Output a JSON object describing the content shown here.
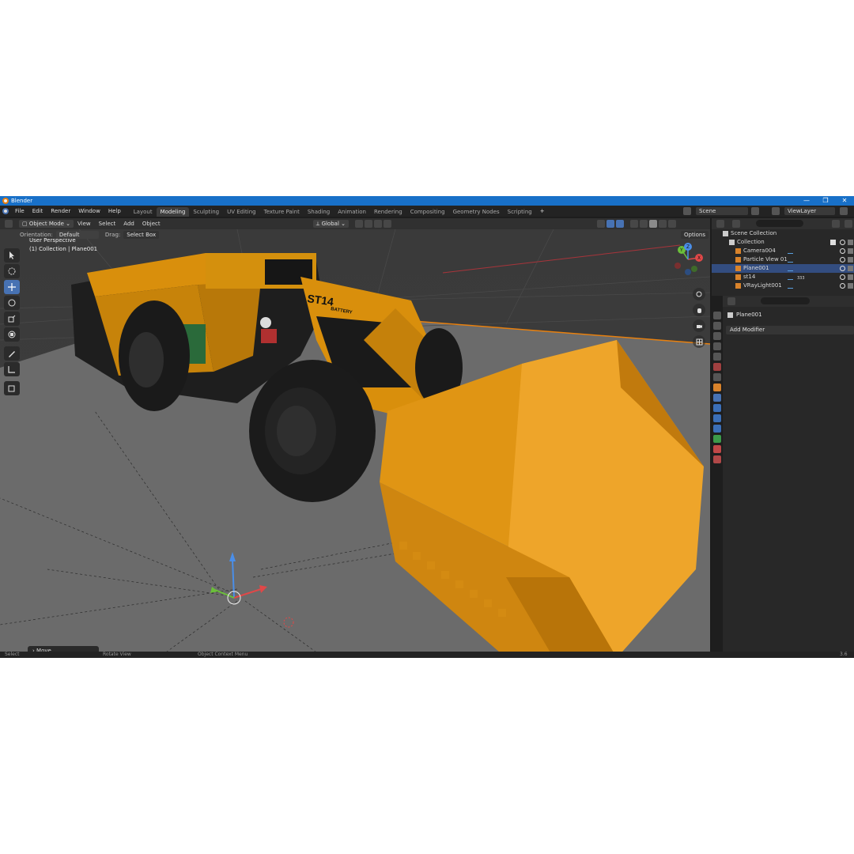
{
  "window": {
    "title": "Blender",
    "min": "—",
    "max": "❐",
    "close": "✕"
  },
  "menu": [
    "File",
    "Edit",
    "Render",
    "Window",
    "Help"
  ],
  "workspaces": [
    {
      "label": "Layout",
      "active": false
    },
    {
      "label": "Modeling",
      "active": true
    },
    {
      "label": "Sculpting",
      "active": false
    },
    {
      "label": "UV Editing",
      "active": false
    },
    {
      "label": "Texture Paint",
      "active": false
    },
    {
      "label": "Shading",
      "active": false
    },
    {
      "label": "Animation",
      "active": false
    },
    {
      "label": "Rendering",
      "active": false
    },
    {
      "label": "Compositing",
      "active": false
    },
    {
      "label": "Geometry Nodes",
      "active": false
    },
    {
      "label": "Scripting",
      "active": false
    }
  ],
  "add_workspace": "+",
  "scene": {
    "label": "Scene",
    "viewlayer": "ViewLayer"
  },
  "viewport_header": {
    "mode": "Object Mode",
    "menus": [
      "View",
      "Select",
      "Add",
      "Object"
    ],
    "transform_orientation": "Global",
    "orientation_label": "Orientation:",
    "orientation_value": "Default",
    "drag_label": "Drag:",
    "drag_value": "Select Box",
    "options": "Options"
  },
  "viewport": {
    "perspective": "User Perspective",
    "collection_info": "(1) Collection | Plane001",
    "model_text": "ST14",
    "model_subtext": "BATTERY",
    "last_operator": "Move",
    "gizmo_axes": [
      "X",
      "Y",
      "Z"
    ]
  },
  "outliner": {
    "root": "Scene Collection",
    "collection": "Collection",
    "items": [
      {
        "label": "Camera004",
        "selected": false,
        "extra": ""
      },
      {
        "label": "Particle View 01",
        "selected": false,
        "extra": ""
      },
      {
        "label": "Plane001",
        "selected": true,
        "extra": ""
      },
      {
        "label": "st14",
        "selected": false,
        "extra": "333"
      },
      {
        "label": "VRayLight001",
        "selected": false,
        "extra": ""
      }
    ]
  },
  "properties": {
    "object_name": "Plane001",
    "add_modifier": "Add Modifier"
  },
  "status": {
    "left": "Select",
    "middle": "Rotate View",
    "right": "Object Context Menu",
    "version": "3.6"
  },
  "colors": {
    "accent": "#4772b3",
    "title_bar": "#1870c8",
    "machine_yellow": "#e0960c",
    "bucket": "#e8a020"
  }
}
